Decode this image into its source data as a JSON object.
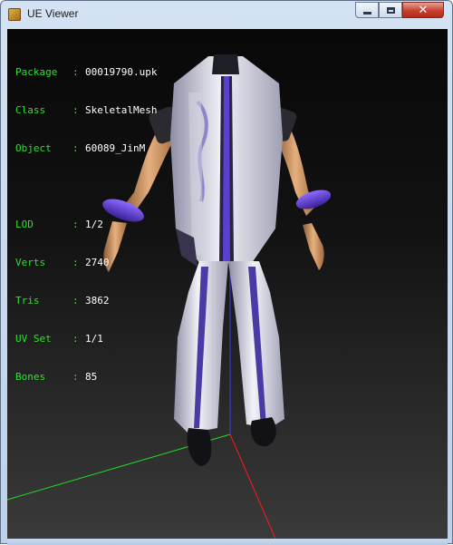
{
  "window": {
    "title": "UE Viewer"
  },
  "controls": {
    "minimize_icon": "minimize-icon",
    "maximize_icon": "maximize-icon",
    "close_icon": "close-icon",
    "close_glyph": "✕"
  },
  "info": {
    "package": {
      "label": "Package",
      "value": "00019790.upk"
    },
    "class": {
      "label": "Class",
      "value": "SkeletalMesh"
    },
    "object": {
      "label": "Object",
      "value": "60089_JinM"
    },
    "lod": {
      "label": "LOD",
      "value": "1/2"
    },
    "verts": {
      "label": "Verts",
      "value": "2740"
    },
    "tris": {
      "label": "Tris",
      "value": "3862"
    },
    "uvset": {
      "label": "UV Set",
      "value": "1/1"
    },
    "bones": {
      "label": "Bones",
      "value": "85"
    }
  },
  "colors": {
    "label_green": "#2fe02f",
    "value_white": "#ffffff",
    "axis_x": "#ff1a1a",
    "axis_y": "#22dd22",
    "axis_z": "#3b3bff",
    "outfit_accent": "#6b4ad8"
  }
}
